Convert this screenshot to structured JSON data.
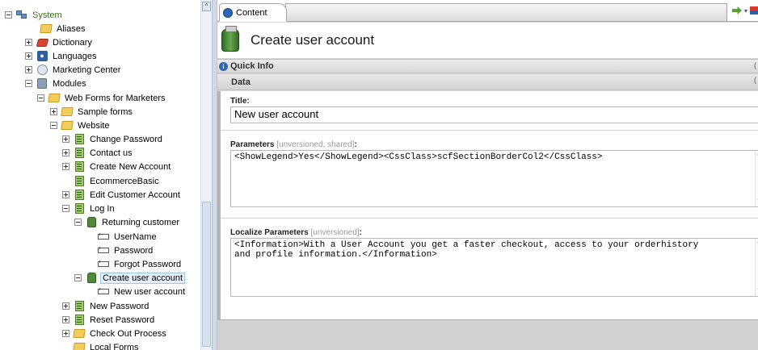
{
  "tree": {
    "items": [
      {
        "label": "System",
        "icon": "system-icon",
        "toggle": "minus"
      },
      {
        "label": "Aliases",
        "icon": "folder-icon",
        "toggle": "none"
      },
      {
        "label": "Dictionary",
        "icon": "dictionary-icon",
        "toggle": "plus"
      },
      {
        "label": "Languages",
        "icon": "languages-icon",
        "toggle": "plus"
      },
      {
        "label": "Marketing Center",
        "icon": "marketing-center-icon",
        "toggle": "plus"
      },
      {
        "label": "Modules",
        "icon": "modules-icon",
        "toggle": "minus"
      },
      {
        "label": "Web Forms for Marketers",
        "icon": "folder-icon",
        "toggle": "minus"
      },
      {
        "label": "Sample forms",
        "icon": "folder-icon",
        "toggle": "plus"
      },
      {
        "label": "Website",
        "icon": "folder-icon",
        "toggle": "minus"
      },
      {
        "label": "Change Password",
        "icon": "form-icon",
        "toggle": "plus"
      },
      {
        "label": "Contact us",
        "icon": "form-icon",
        "toggle": "plus"
      },
      {
        "label": "Create New Account",
        "icon": "form-icon",
        "toggle": "plus"
      },
      {
        "label": "EcommerceBasic",
        "icon": "form-icon",
        "toggle": "none"
      },
      {
        "label": "Edit Customer Account",
        "icon": "form-icon",
        "toggle": "plus"
      },
      {
        "label": "Log In",
        "icon": "form-icon",
        "toggle": "minus"
      },
      {
        "label": "Returning customer",
        "icon": "section-icon",
        "toggle": "minus"
      },
      {
        "label": "UserName",
        "icon": "field-icon",
        "toggle": "none"
      },
      {
        "label": "Password",
        "icon": "field-icon",
        "toggle": "none"
      },
      {
        "label": "Forgot Password",
        "icon": "field-icon",
        "toggle": "none"
      },
      {
        "label": "Create user account",
        "icon": "section-icon",
        "toggle": "minus",
        "selected": true
      },
      {
        "label": "New user account",
        "icon": "field-icon",
        "toggle": "none"
      },
      {
        "label": "New Password",
        "icon": "form-icon",
        "toggle": "plus"
      },
      {
        "label": "Reset Password",
        "icon": "form-icon",
        "toggle": "plus"
      },
      {
        "label": "Check Out Process",
        "icon": "folder-icon",
        "toggle": "plus"
      },
      {
        "label": "Local Forms",
        "icon": "folder-icon",
        "toggle": "none"
      }
    ]
  },
  "tab": {
    "label": "Content",
    "icon": "content-tab-icon"
  },
  "header": {
    "title": "Create user account",
    "icon": "section-icon"
  },
  "quick_info": {
    "label": "Quick Info",
    "icon": "info-icon"
  },
  "data_section": {
    "label": "Data"
  },
  "fields": {
    "title": {
      "label": "Title:",
      "value": "New user account"
    },
    "parameters": {
      "label": "Parameters",
      "note": "[unversioned, shared]",
      "suffix": ":",
      "value": "<ShowLegend>Yes</ShowLegend><CssClass>scfSectionBorderCol2</CssClass>"
    },
    "localize_parameters": {
      "label": "Localize Parameters",
      "note": "[unversioned]",
      "suffix": ":",
      "value_line1": "<Information>With a User Account you get a faster checkout, access to your orderhistory",
      "value_line2": "and profile information.</Information>"
    }
  },
  "colors": {
    "selected_bg": "#e6f0fa",
    "selected_border": "#9dc4ea",
    "system_text": "#3b6f1b"
  }
}
